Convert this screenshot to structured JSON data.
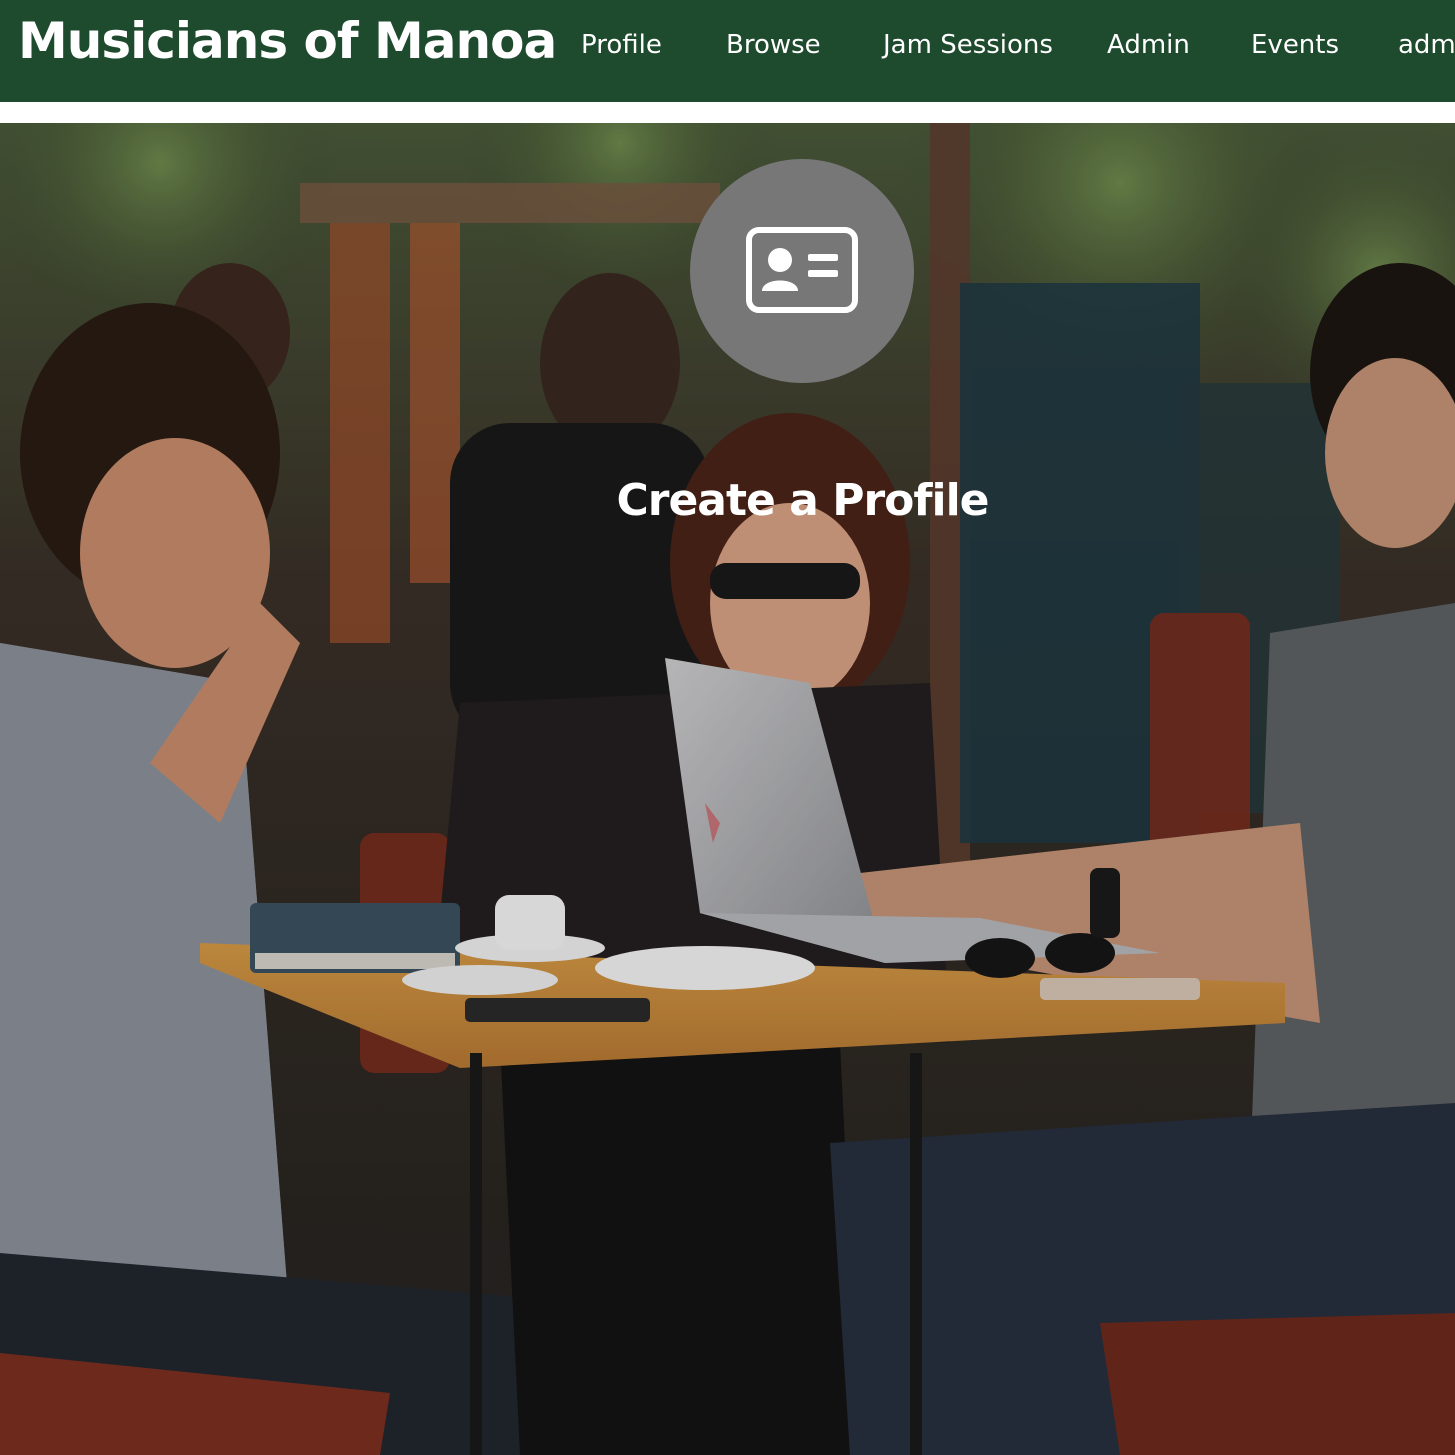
{
  "navbar": {
    "brand": "Musicians of Manoa",
    "items": [
      {
        "label": "Profile"
      },
      {
        "label": "Browse"
      },
      {
        "label": "Jam Sessions"
      },
      {
        "label": "Admin"
      },
      {
        "label": "Events"
      },
      {
        "label": "admin"
      }
    ],
    "background_color": "#1e4a2e"
  },
  "hero": {
    "icon": "id-card-icon",
    "title": "Create a Profile",
    "icon_circle_color": "#777777"
  }
}
